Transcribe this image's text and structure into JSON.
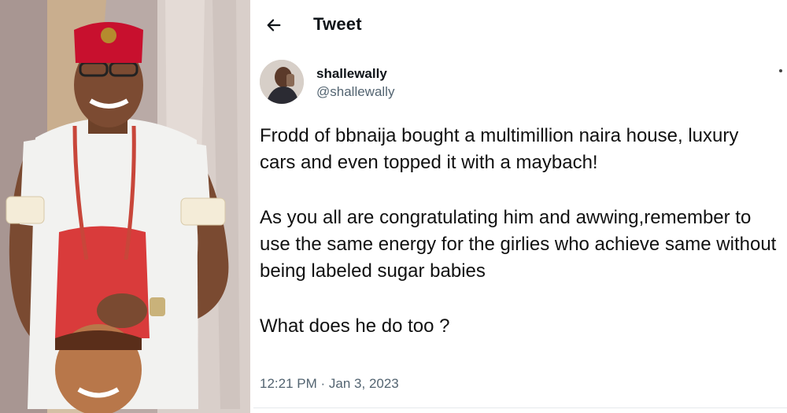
{
  "header": {
    "title": "Tweet",
    "back_icon": "arrow-left-icon"
  },
  "author": {
    "display_name": "shallewally",
    "handle": "@shallewally"
  },
  "tweet": {
    "paragraphs": [
      "Frodd of bbnaija bought a multimillion naira house, luxury cars and even topped it with a maybach!",
      "As you all are congratulating him and awwing,remember to use the same energy for the girlies who achieve same without being labeled sugar babies",
      "What does he do too ?"
    ],
    "time": "12:21 PM",
    "separator": "·",
    "date": "Jan 3, 2023"
  },
  "colors": {
    "text": "#0f1419",
    "secondary": "#536471",
    "cap_red": "#c8102e",
    "outfit_white": "#f2f2f0"
  }
}
